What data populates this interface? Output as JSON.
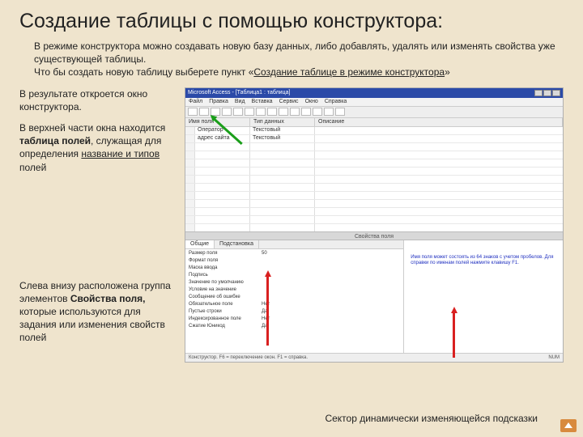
{
  "title": "Создание таблицы с помощью конструктора:",
  "intro": {
    "p1": "В режиме конструктора можно создавать новую базу данных, либо добавлять, удалять или изменять свойства уже существующей таблицы.",
    "p2a": "Что бы создать новую таблицу выберете пункт «",
    "p2link": "Создание таблице в режиме конструктора",
    "p2b": "»"
  },
  "left": {
    "p1": "В результате откроется окно конструктора.",
    "p2a": "В верхней части окна находится ",
    "p2b": "таблица полей",
    "p2c": ", служащая для определения ",
    "p2d": "название и типов",
    "p2e": " полей",
    "p3a": "Слева внизу расположена группа элементов ",
    "p3b": "Свойства поля,",
    "p3c": " которые используются для задания или изменения свойств полей"
  },
  "footer": "Сектор динамически изменяющейся подсказки",
  "app": {
    "title": "Microsoft Access - [Таблица1 : таблица]",
    "menu": [
      "Файл",
      "Правка",
      "Вид",
      "Вставка",
      "Сервис",
      "Окно",
      "Справка"
    ],
    "cols": {
      "c1": "Имя поля",
      "c2": "Тип данных",
      "c3": "Описание"
    },
    "rows": [
      {
        "name": "Оператор",
        "type": "Текстовый"
      },
      {
        "name": "адрес сайта",
        "type": "Текстовый"
      }
    ],
    "divider": "Свойства поля",
    "tabs": [
      "Общие",
      "Подстановка"
    ],
    "props": [
      {
        "n": "Размер поля",
        "v": "50"
      },
      {
        "n": "Формат поля",
        "v": ""
      },
      {
        "n": "Маска ввода",
        "v": ""
      },
      {
        "n": "Подпись",
        "v": ""
      },
      {
        "n": "Значение по умолчанию",
        "v": ""
      },
      {
        "n": "Условие на значение",
        "v": ""
      },
      {
        "n": "Сообщение об ошибке",
        "v": ""
      },
      {
        "n": "Обязательное поле",
        "v": "Нет"
      },
      {
        "n": "Пустые строки",
        "v": "Да"
      },
      {
        "n": "Индексированное поле",
        "v": "Нет"
      },
      {
        "n": "Сжатие Юникод",
        "v": "Да"
      }
    ],
    "hint": "Имя поля может состоять из 64 знаков с учетом пробелов. Для справки по именам полей нажмите клавишу F1.",
    "status": {
      "left": "Конструктор. F6 = переключение окон. F1 = справка.",
      "right": "NUM"
    }
  }
}
